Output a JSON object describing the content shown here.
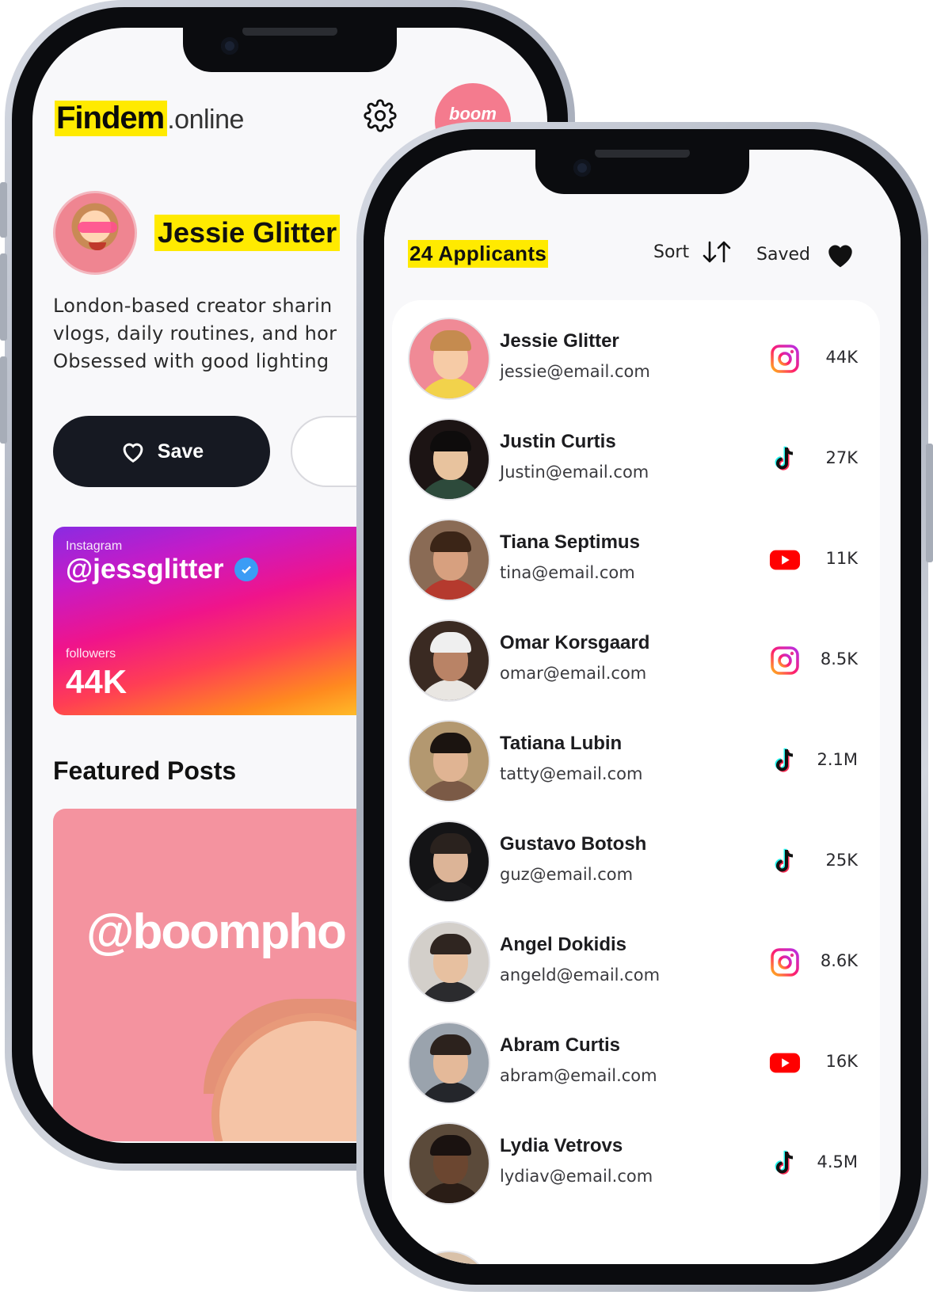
{
  "profile_screen": {
    "brand_strong": "Findem",
    "brand_light": ".online",
    "logo_text": "boom",
    "name": "Jessie Glitter",
    "bio": "London-based creator sharin\nvlogs, daily routines, and hor\nObsessed with good lighting",
    "save_label": "Save",
    "instagram": {
      "label": "Instagram",
      "handle": "@jessglitter",
      "followers_label": "followers",
      "followers_value": "44K"
    },
    "featured_title": "Featured Posts",
    "featured_tag": "@boompho"
  },
  "applicants_screen": {
    "title": "24 Applicants",
    "sort_label": "Sort",
    "saved_label": "Saved",
    "applicants": [
      {
        "name": "Jessie Glitter",
        "email": "jessie@email.com",
        "platform": "instagram",
        "count": "44K"
      },
      {
        "name": "Justin Curtis",
        "email": "Justin@email.com",
        "platform": "tiktok",
        "count": "27K"
      },
      {
        "name": "Tiana Septimus",
        "email": "tina@email.com",
        "platform": "youtube",
        "count": "11K"
      },
      {
        "name": "Omar Korsgaard",
        "email": "omar@email.com",
        "platform": "instagram",
        "count": "8.5K"
      },
      {
        "name": "Tatiana Lubin",
        "email": "tatty@email.com",
        "platform": "tiktok",
        "count": "2.1M"
      },
      {
        "name": "Gustavo Botosh",
        "email": "guz@email.com",
        "platform": "tiktok",
        "count": "25K"
      },
      {
        "name": "Angel Dokidis",
        "email": "angeld@email.com",
        "platform": "instagram",
        "count": "8.6K"
      },
      {
        "name": "Abram Curtis",
        "email": "abram@email.com",
        "platform": "youtube",
        "count": "16K"
      },
      {
        "name": "Lydia Vetrovs",
        "email": "lydiav@email.com",
        "platform": "tiktok",
        "count": "4.5M"
      }
    ]
  },
  "colors": {
    "highlight": "#ffea00",
    "dark_button": "#161922",
    "instagram_gradient_start": "#8a2be2",
    "instagram_gradient_end": "#ffc52a",
    "youtube_red": "#ff0000",
    "tiktok_cyan": "#25f4ee",
    "tiktok_pink": "#fe2c55",
    "brand_pink": "#f47b8e"
  }
}
